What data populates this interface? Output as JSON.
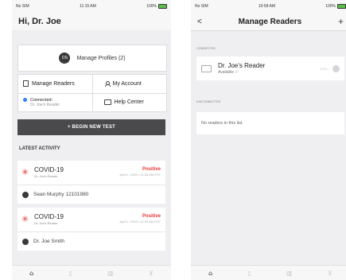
{
  "left": {
    "status": {
      "carrier": "No SIM",
      "time": "11:15 AM",
      "battery": "100%"
    },
    "greeting": "Hi, Dr. Joe",
    "profiles": {
      "avatar_initials": "DS",
      "label": "Manage Profiles (2)"
    },
    "menu": {
      "manage_readers": "Manage Readers",
      "connected": "Connected:",
      "connected_reader": "Dr. Joe's Reader",
      "my_account": "My Account",
      "help_center": "Help Center"
    },
    "begin_button": "+ BEGIN NEW TEST",
    "latest_title": "LATEST ACTIVITY",
    "activity": [
      {
        "test": "COVID-19",
        "reader": "Dr. Joe's Reader",
        "result": "Positive",
        "date": "April 1, 2020 • 11:30 AM PST",
        "person": "Sean Murphy 12101980"
      },
      {
        "test": "COVID-19",
        "reader": "Dr. Joe's Reader",
        "result": "Positive",
        "date": "April 1, 2020 • 11:30 AM PST",
        "person": "Dr. Joe Smith"
      }
    ],
    "tabs": [
      "home-icon",
      "bookmark-icon",
      "building-icon",
      "cart-icon"
    ]
  },
  "right": {
    "status": {
      "carrier": "No SIM",
      "time": "10:58 AM",
      "battery": "100%"
    },
    "nav": {
      "back": "<",
      "title": "Manage Readers",
      "add": "+"
    },
    "connected_label": "CONNECTED",
    "reader": {
      "name": "Dr. Joe's Reader",
      "status": "Available",
      "meta": "37% • ›"
    },
    "disconnected_label": "DISCONNECTED",
    "empty_text": "No readers in this list.",
    "tabs": [
      "home-icon",
      "bookmark-icon",
      "building-icon",
      "cart-icon"
    ]
  },
  "colors": {
    "accent": "#2f80ed",
    "danger": "#e53935",
    "button": "#4a4a4d"
  }
}
